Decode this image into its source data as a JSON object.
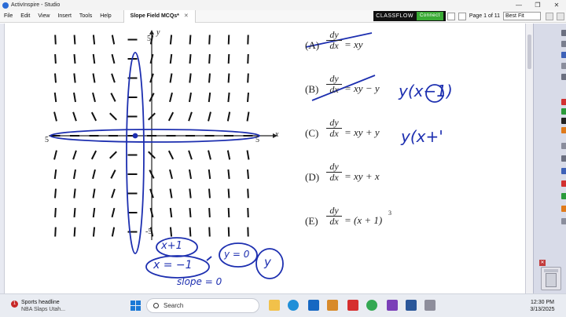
{
  "window": {
    "title": "ActivInspire - Studio"
  },
  "menu": {
    "items": [
      "File",
      "Edit",
      "View",
      "Insert",
      "Tools",
      "Help"
    ]
  },
  "document_tab": {
    "label": "Slope Field MCQs*",
    "close": "✕"
  },
  "classflow": {
    "brand": "CLASSFLOW",
    "connect_label": "Connect"
  },
  "toolbar": {
    "page_label": "Page 1 of 11",
    "zoom_value": "Best Fit"
  },
  "graph": {
    "x_axis_var": "x",
    "y_axis_var": "y",
    "x_min_label": "5",
    "x_max_label": "5",
    "y_max_label": "5",
    "y_min_label": "-5"
  },
  "choices": [
    {
      "letter": "(A)",
      "num": "dy",
      "den": "dx",
      "rhs": "= xy"
    },
    {
      "letter": "(B)",
      "num": "dy",
      "den": "dx",
      "rhs": "= xy − y"
    },
    {
      "letter": "(C)",
      "num": "dy",
      "den": "dx",
      "rhs": "= xy + y"
    },
    {
      "letter": "(D)",
      "num": "dy",
      "den": "dx",
      "rhs": "= xy + x"
    },
    {
      "letter": "(E)",
      "num": "dy",
      "den": "dx",
      "rhs": "= (x + 1)",
      "exponent": "3"
    }
  ],
  "annotations": {
    "b_factored": "y(x−1)",
    "c_factored": "y(x+'",
    "x_plus_one": "x+1",
    "x_equals": "x = −1",
    "y_equals": "y = 0",
    "y_circled": "y",
    "slope_note": "slope = 0"
  },
  "colors": {
    "ink": "#1d2fb0",
    "accent_green": "#3aaa35"
  },
  "taskbar": {
    "news_badge": "1",
    "news_title": "Sports headline",
    "news_subtitle": "NBA Slaps Utah...",
    "search_placeholder": "Search",
    "time": "12:30 PM",
    "date": "3/13/2025"
  }
}
